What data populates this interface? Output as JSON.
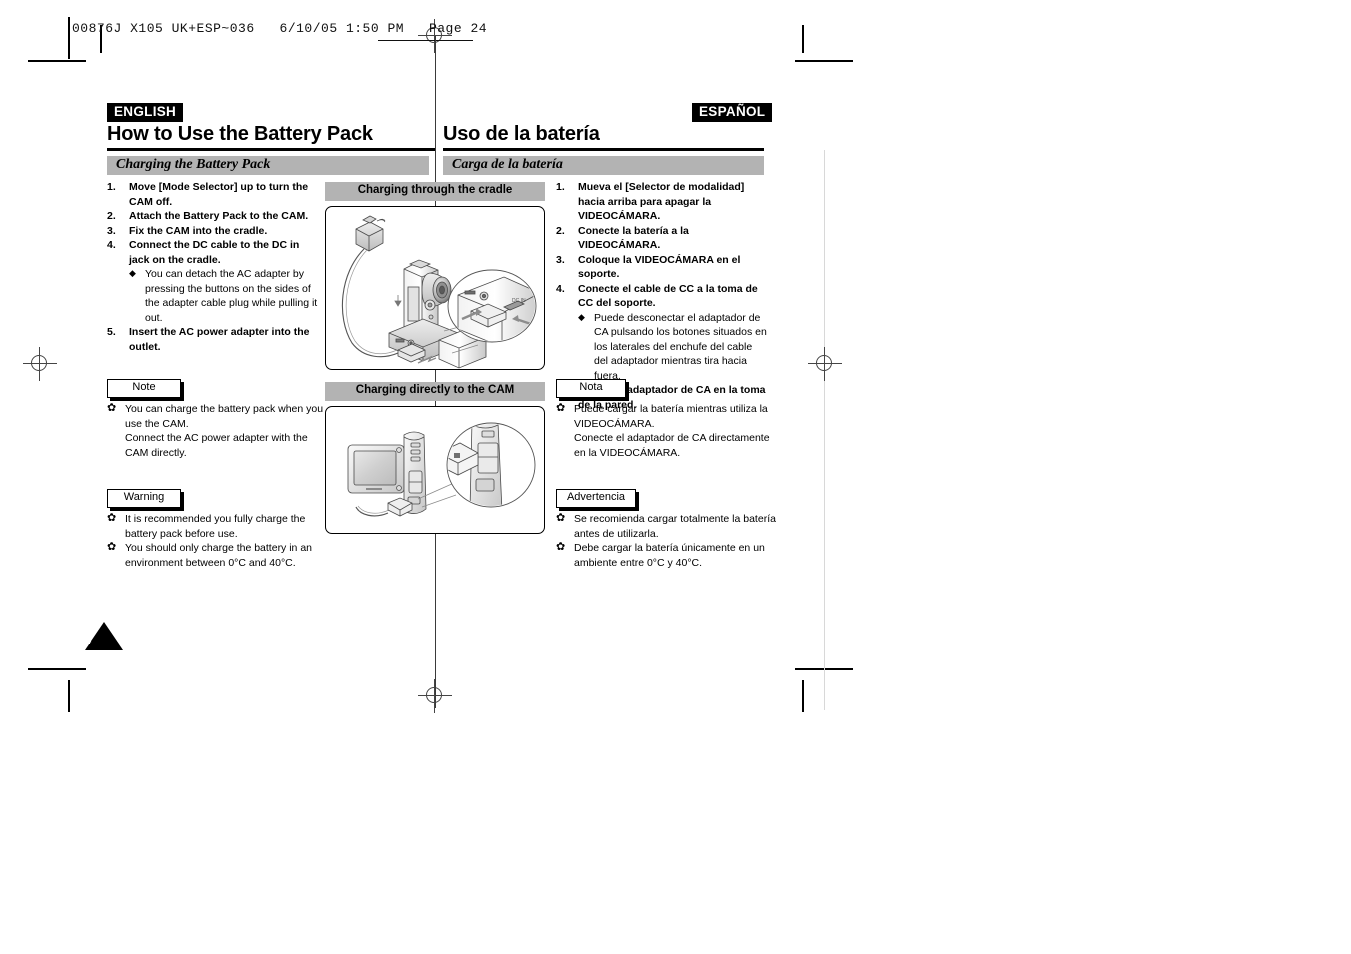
{
  "printer_slug": {
    "text": "00876J X105 UK+ESP~036   6/10/05 1:50 PM   Page 24"
  },
  "page_number": "24",
  "columns": {
    "english": {
      "language_badge": "ENGLISH",
      "title": "How to Use the Battery Pack",
      "section_heading": "Charging the Battery Pack",
      "steps": [
        {
          "num": "1.",
          "text": "Move [Mode Selector] up to turn the CAM off."
        },
        {
          "num": "2.",
          "text": "Attach the Battery Pack to the CAM."
        },
        {
          "num": "3.",
          "text": "Fix the CAM into the cradle."
        },
        {
          "num": "4.",
          "text": "Connect the DC cable to the DC in jack on the cradle."
        },
        {
          "num": "5.",
          "text": "Insert the AC power adapter into the outlet."
        }
      ],
      "substep_after_step": 4,
      "substep_text": "You can detach the AC adapter by pressing the buttons on the sides of the adapter cable plug while pulling it out.",
      "note_label": "Note",
      "note_bullets": [
        "You can charge the battery pack when you use the CAM.",
        "Connect the AC power adapter with the CAM directly."
      ],
      "warning_label": "Warning",
      "warning_bullets": [
        "It is recommended you fully charge the battery pack before use.",
        "You should only charge the battery in an environment between 0°C and 40°C."
      ]
    },
    "spanish": {
      "language_badge": "ESPAÑOL",
      "title": "Uso de la batería",
      "section_heading": "Carga de la batería",
      "steps": [
        {
          "num": "1.",
          "text": "Mueva el [Selector de modalidad] hacia arriba para apagar la VIDEOCÁMARA."
        },
        {
          "num": "2.",
          "text": "Conecte la batería a la VIDEOCÁMARA."
        },
        {
          "num": "3.",
          "text": "Coloque la VIDEOCÁMARA en el soporte."
        },
        {
          "num": "4.",
          "text": "Conecte el cable de CC a la toma de CC del soporte."
        },
        {
          "num": "5.",
          "text": "Inserte el adaptador de CA en la toma de la pared."
        }
      ],
      "substep_after_step": 4,
      "substep_text": "Puede desconectar el adaptador de CA pulsando los botones situados en los laterales del enchufe del cable del adaptador mientras tira hacia fuera.",
      "note_label": "Nota",
      "note_bullets": [
        "Puede cargar la batería mientras utiliza la VIDEOCÁMARA.",
        "Conecte el adaptador de CA directamente en la VIDEOCÁMARA."
      ],
      "warning_label": "Advertencia",
      "warning_bullets": [
        "Se recomienda cargar totalmente la batería antes de utilizarla.",
        "Debe cargar la batería únicamente en un ambiente entre 0°C y 40°C."
      ]
    }
  },
  "illustrations": [
    {
      "caption": "Charging through the cradle",
      "alt": "camcorder seated in cradle with DC cable and AC adapter, with zoom callout of the DC-in jack"
    },
    {
      "caption": "Charging directly to the CAM",
      "alt": "camcorder with LCD open and DC cable plugged directly into the CAM, with zoom callout of the jack"
    }
  ],
  "colors": {
    "section_bar": "#b3b3b3",
    "badge_bg": "#000000",
    "rule": "#000000"
  }
}
